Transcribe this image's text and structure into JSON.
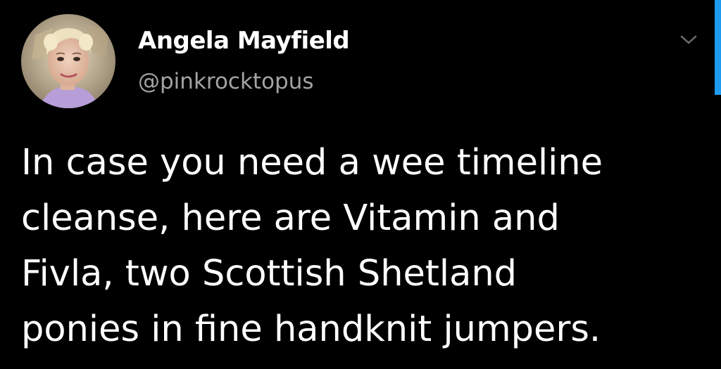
{
  "author": {
    "display_name": "Angela Mayfield",
    "handle": "@pinkrocktopus"
  },
  "tweet": {
    "lines": [
      "In case you need a wee timeline",
      "cleanse, here are Vitamin and",
      "Fivla, two Scottish Shetland",
      "ponies in fine handknit jumpers."
    ]
  },
  "icons": {
    "menu": "chevron-down-icon",
    "avatar": "profile-photo"
  },
  "colors": {
    "background": "#000000",
    "primary_text": "#ffffff",
    "secondary_text": "#a3a3a3",
    "accent": "#1d9bf0"
  }
}
